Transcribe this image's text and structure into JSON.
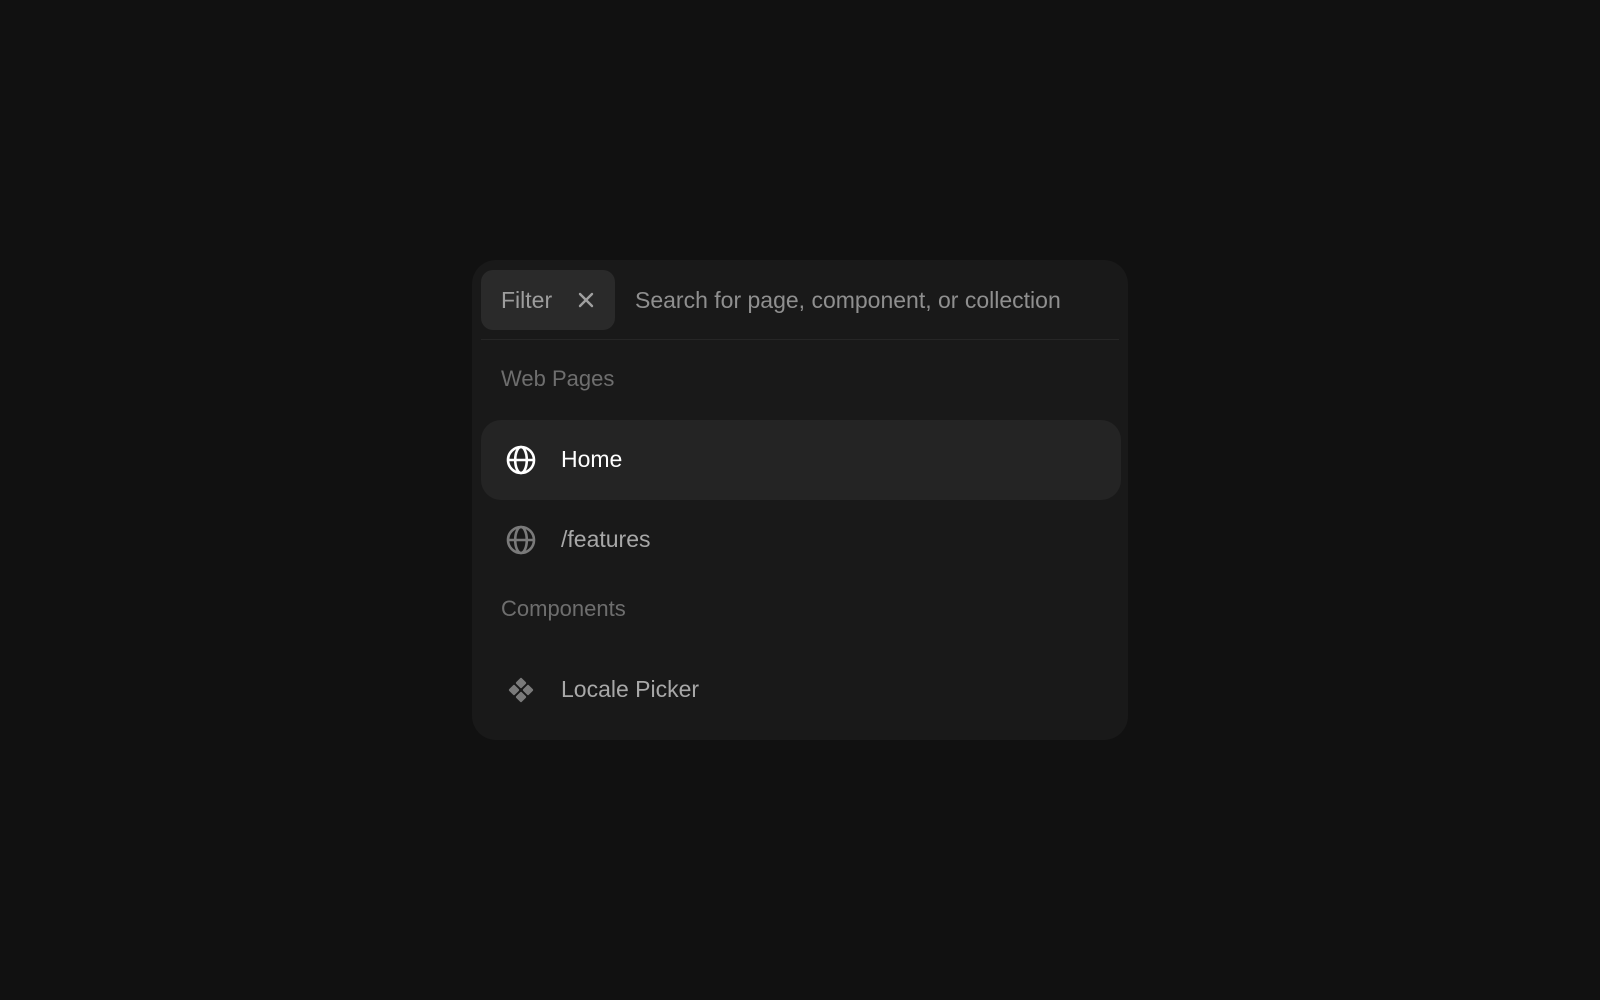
{
  "filter": {
    "label": "Filter",
    "close_icon": "close-icon"
  },
  "search": {
    "placeholder": "Search for page, component, or collection"
  },
  "sections": [
    {
      "heading": "Web Pages",
      "items": [
        {
          "label": "Home",
          "icon": "globe-icon",
          "active": true
        },
        {
          "label": "/features",
          "icon": "globe-icon",
          "active": false
        }
      ]
    },
    {
      "heading": "Components",
      "items": [
        {
          "label": "Locale Picker",
          "icon": "component-icon",
          "active": false
        }
      ]
    }
  ],
  "colors": {
    "background": "#111111",
    "panel": "#191919",
    "active_row": "#242424",
    "chip": "#2a2a2a"
  }
}
